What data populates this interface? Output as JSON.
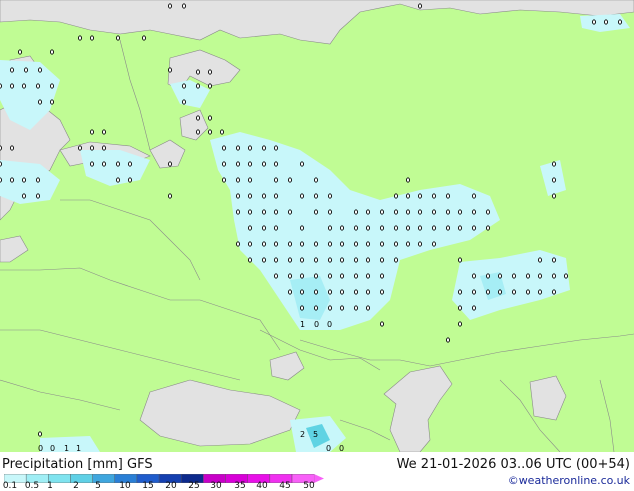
{
  "title": "Precipitation [mm]  GFS",
  "valid_time": "We 21-01-2026 03..06 UTC (00+54)",
  "credit": "©weatheronline.co.uk",
  "legend": {
    "labels": [
      "0.1",
      "0.5",
      "1",
      "2",
      "5",
      "10",
      "15",
      "20",
      "25",
      "30",
      "35",
      "40",
      "45",
      "50"
    ],
    "colors": [
      "#c8f7fa",
      "#a0eef5",
      "#7fe3ef",
      "#5fd0e6",
      "#3fa6de",
      "#2a7fd6",
      "#1f5ccc",
      "#1540b0",
      "#0d2a8c",
      "#c800c8",
      "#d800d8",
      "#e810e8",
      "#f030f0",
      "#f860f8"
    ]
  },
  "colors": {
    "land": "#c0fc94",
    "water": "#e2e2e2",
    "precip_light": "#c8f7fa",
    "precip_medium": "#a6eef5",
    "precip_heavy": "#5fd3e3"
  },
  "station_values": {
    "row_390": [
      "1",
      "0",
      "0"
    ],
    "caspian": [
      "2",
      "5",
      "0",
      "0"
    ],
    "corner_sw": [
      "0",
      "0",
      "1",
      "1"
    ]
  }
}
